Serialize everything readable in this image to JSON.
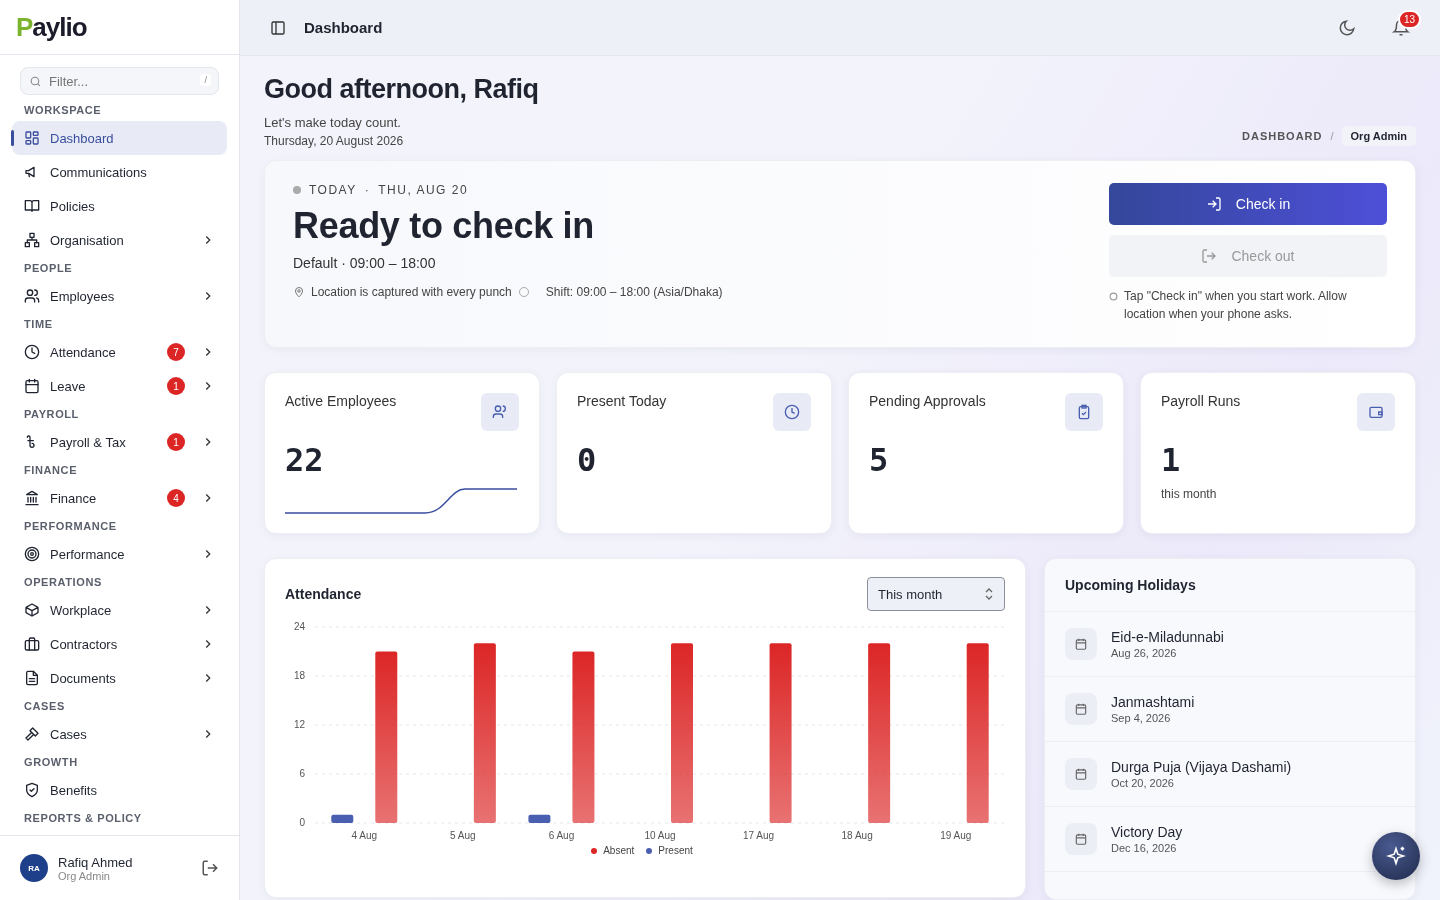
{
  "brand": {
    "name": "aylio",
    "initial": "P"
  },
  "sidebar": {
    "filter": {
      "placeholder": "Filter...",
      "shortcut": "/"
    },
    "sections": [
      {
        "title": "WORKSPACE",
        "items": [
          {
            "label": "Dashboard",
            "selected": true,
            "expandable": false
          },
          {
            "label": "Communications",
            "selected": false,
            "expandable": false
          },
          {
            "label": "Policies",
            "selected": false,
            "expandable": false
          },
          {
            "label": "Organisation",
            "selected": false,
            "expandable": true
          }
        ]
      },
      {
        "title": "PEOPLE",
        "items": [
          {
            "label": "Employees",
            "selected": false,
            "expandable": true
          }
        ]
      },
      {
        "title": "TIME",
        "items": [
          {
            "label": "Attendance",
            "selected": false,
            "expandable": true,
            "badge": "7"
          },
          {
            "label": "Leave",
            "selected": false,
            "expandable": true,
            "badge": "1"
          }
        ]
      },
      {
        "title": "PAYROLL",
        "items": [
          {
            "label": "Payroll & Tax",
            "selected": false,
            "expandable": true,
            "badge": "1"
          }
        ]
      },
      {
        "title": "FINANCE",
        "items": [
          {
            "label": "Finance",
            "selected": false,
            "expandable": true,
            "badge": "4"
          }
        ]
      },
      {
        "title": "PERFORMANCE",
        "items": [
          {
            "label": "Performance",
            "selected": false,
            "expandable": true
          }
        ]
      },
      {
        "title": "OPERATIONS",
        "items": [
          {
            "label": "Workplace",
            "selected": false,
            "expandable": true
          },
          {
            "label": "Contractors",
            "selected": false,
            "expandable": true
          },
          {
            "label": "Documents",
            "selected": false,
            "expandable": true
          }
        ]
      },
      {
        "title": "CASES",
        "items": [
          {
            "label": "Cases",
            "selected": false,
            "expandable": true
          }
        ]
      },
      {
        "title": "GROWTH",
        "items": [
          {
            "label": "Benefits",
            "selected": false,
            "expandable": false
          }
        ]
      },
      {
        "title": "REPORTS & POLICY"
      }
    ],
    "user": {
      "initials": "RA",
      "name": "Rafiq Ahmed",
      "role": "Org Admin"
    }
  },
  "header": {
    "title": "Dashboard",
    "notifications": "13"
  },
  "greeting": {
    "title": "Good afternoon, Rafiq",
    "subtitle": "Let's make today count.",
    "date": "Thursday, 20 August 2026",
    "breadcrumb": "DASHBOARD",
    "separator": "/",
    "role": "Org Admin"
  },
  "checkin": {
    "eyebrow": "TODAY",
    "eyebrow_separator": "·",
    "eyebrow_date": "THU, AUG 20",
    "title": "Ready to check in",
    "shift": "Default · 09:00 – 18:00",
    "location_note": "Location is captured with every punch",
    "shift_note": "Shift: 09:00 – 18:00 (Asia/Dhaka)",
    "check_in": {
      "label": "Check in",
      "disabled": false
    },
    "check_out": {
      "label": "Check out",
      "disabled": true
    },
    "hint": "Tap \"Check in\" when you start work. Allow location when your phone asks."
  },
  "stats": [
    {
      "label": "Active Employees",
      "value": "22",
      "kind": "sparkline"
    },
    {
      "label": "Present Today",
      "value": "0",
      "kind": "plain"
    },
    {
      "label": "Pending Approvals",
      "value": "5",
      "kind": "plain"
    },
    {
      "label": "Payroll Runs",
      "value": "1",
      "kind": "note",
      "note": "this month"
    }
  ],
  "attendance": {
    "title": "Attendance",
    "period": "This month",
    "chart_data": {
      "type": "bar",
      "grid": true,
      "categories": [
        "4 Aug",
        "5 Aug",
        "6 Aug",
        "10 Aug",
        "17 Aug",
        "18 Aug",
        "19 Aug"
      ],
      "ylim": [
        0,
        24
      ],
      "yticks": [
        0,
        6,
        12,
        18,
        24
      ],
      "series": [
        {
          "name": "Present",
          "color": "#4a5fb0",
          "values": [
            1,
            0,
            1,
            0,
            0,
            0,
            0
          ]
        },
        {
          "name": "Absent",
          "color": "#dc2626",
          "values": [
            21,
            22,
            21,
            22,
            22,
            22,
            22
          ]
        }
      ]
    }
  },
  "holidays": {
    "title": "Upcoming Holidays",
    "items": [
      {
        "name": "Eid-e-Miladunnabi",
        "date": "Aug 26, 2026"
      },
      {
        "name": "Janmashtami",
        "date": "Sep 4, 2026"
      },
      {
        "name": "Durga Puja (Vijaya Dashami)",
        "date": "Oct 20, 2026"
      },
      {
        "name": "Victory Day",
        "date": "Dec 16, 2026"
      }
    ]
  }
}
